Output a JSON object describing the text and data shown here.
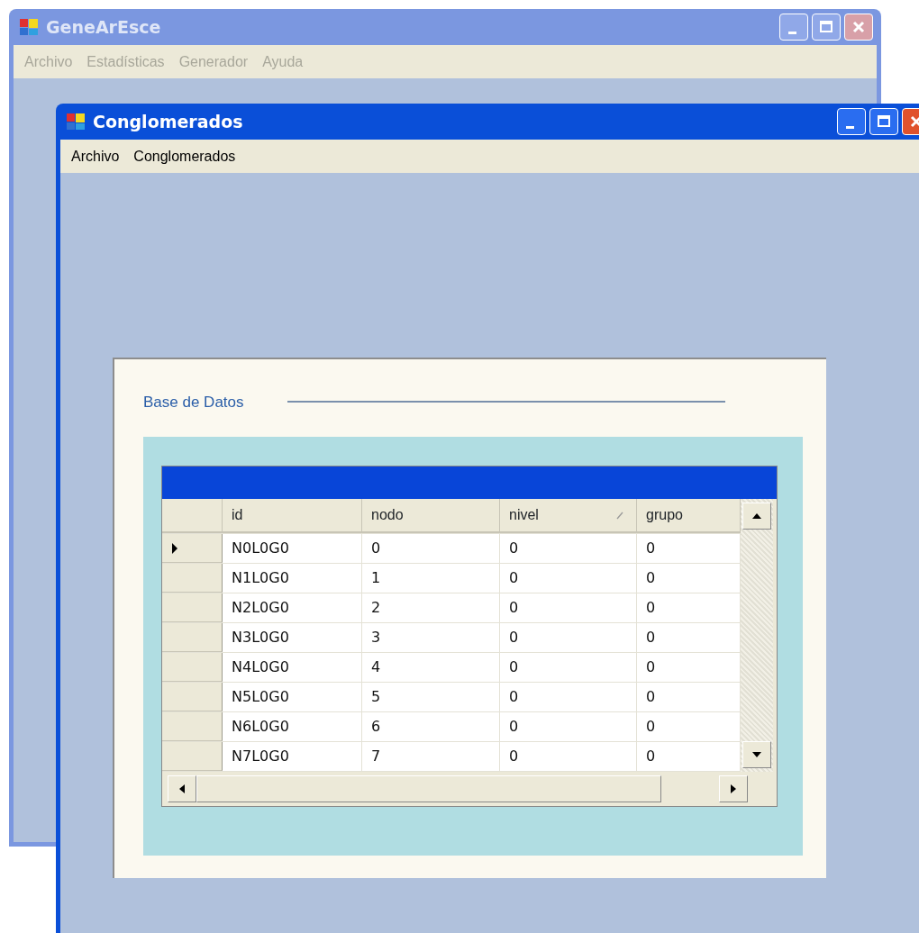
{
  "outer_window": {
    "title": "GeneArEsce",
    "active": false,
    "menu": [
      {
        "label": "Archivo",
        "disabled": true
      },
      {
        "label": "Estadísticas",
        "disabled": true
      },
      {
        "label": "Generador",
        "disabled": true
      },
      {
        "label": "Ayuda",
        "disabled": true
      }
    ]
  },
  "inner_window": {
    "title": "Conglomerados",
    "active": true,
    "menu": [
      {
        "label": "Archivo",
        "disabled": false
      },
      {
        "label": "Conglomerados",
        "disabled": false
      }
    ],
    "database_label": "Base de Datos",
    "grid": {
      "columns": [
        {
          "label": "id",
          "sorted": false
        },
        {
          "label": "nodo",
          "sorted": false
        },
        {
          "label": "nivel",
          "sorted": true
        },
        {
          "label": "grupo",
          "sorted": false
        }
      ],
      "rows": [
        {
          "selected": true,
          "cells": [
            "N0L0G0",
            "0",
            "0",
            "0"
          ]
        },
        {
          "selected": false,
          "cells": [
            "N1L0G0",
            "1",
            "0",
            "0"
          ]
        },
        {
          "selected": false,
          "cells": [
            "N2L0G0",
            "2",
            "0",
            "0"
          ]
        },
        {
          "selected": false,
          "cells": [
            "N3L0G0",
            "3",
            "0",
            "0"
          ]
        },
        {
          "selected": false,
          "cells": [
            "N4L0G0",
            "4",
            "0",
            "0"
          ]
        },
        {
          "selected": false,
          "cells": [
            "N5L0G0",
            "5",
            "0",
            "0"
          ]
        },
        {
          "selected": false,
          "cells": [
            "N6L0G0",
            "6",
            "0",
            "0"
          ]
        },
        {
          "selected": false,
          "cells": [
            "N7L0G0",
            "7",
            "0",
            "0"
          ]
        }
      ]
    }
  }
}
